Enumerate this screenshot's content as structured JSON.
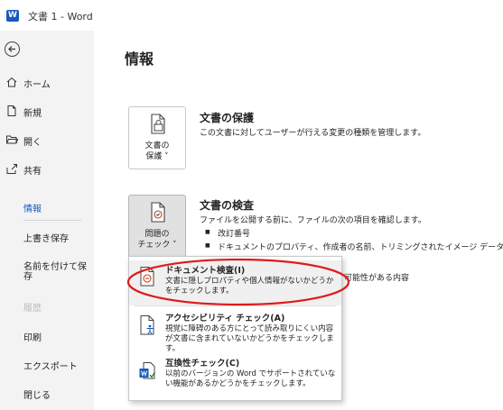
{
  "titlebar": {
    "title": "文書 1  -  Word"
  },
  "sidebar": {
    "items": [
      {
        "label": "ホーム"
      },
      {
        "label": "新規"
      },
      {
        "label": "開く"
      },
      {
        "label": "共有"
      },
      {
        "label": "情報"
      },
      {
        "label": "上書き保存"
      },
      {
        "label": "名前を付けて保存"
      },
      {
        "label": "履歴"
      },
      {
        "label": "印刷"
      },
      {
        "label": "エクスポート"
      },
      {
        "label": "閉じる"
      }
    ],
    "active": "情報"
  },
  "main": {
    "title": "情報",
    "protect": {
      "button_line1": "文書の",
      "button_line2": "保護 ˅",
      "title": "文書の保護",
      "desc": "この文書に対してユーザーが行える変更の種類を管理します。"
    },
    "inspect": {
      "button_line1": "問題の",
      "button_line2": "チェック ˅",
      "title": "文書の検査",
      "desc": "ファイルを公開する前に、ファイルの次の項目を確認します。",
      "bullets": [
        "改訂番号",
        "ドキュメントのプロパティ、作成者の名前、トリミングされたイメージ データ"
      ],
      "trailing_text": "可能性がある内容"
    }
  },
  "dropdown": {
    "items": [
      {
        "title": "ドキュメント検査(I)",
        "desc": "文書に隠しプロパティや個人情報がないかどうかをチェックします。"
      },
      {
        "title": "アクセシビリティ チェック(A)",
        "desc": "視覚に障碍のある方にとって読み取りにくい内容が文書に含まれていないかどうかをチェックします。"
      },
      {
        "title": "互換性チェック(C)",
        "desc": "以前のバージョンの Word でサポートされていない機能があるかどうかをチェックします。"
      }
    ]
  },
  "colors": {
    "accent": "#185abd",
    "highlight_ring": "#e0191b",
    "sidebar_bg": "#f3f3f3"
  },
  "icons": [
    "word-logo-icon",
    "back-arrow-icon",
    "home-icon",
    "new-document-icon",
    "open-folder-icon",
    "share-icon",
    "lock-document-icon",
    "inspect-document-icon",
    "document-inspector-icon",
    "accessibility-icon",
    "compatibility-icon"
  ]
}
